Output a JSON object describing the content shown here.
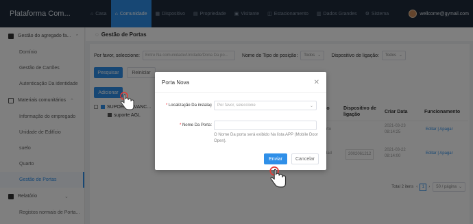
{
  "app": {
    "brand": "Plataforma Com..."
  },
  "nav": [
    {
      "icon": "home-icon",
      "glyph": "⌂",
      "label": "Casa"
    },
    {
      "icon": "community-icon",
      "glyph": "⌂",
      "label": "Comunidade"
    },
    {
      "icon": "device-icon",
      "glyph": "▦",
      "label": "Dispositivo"
    },
    {
      "icon": "property-icon",
      "glyph": "▤",
      "label": "Propriedade"
    },
    {
      "icon": "visitor-icon",
      "glyph": "▣",
      "label": "Visitante"
    },
    {
      "icon": "parking-icon",
      "glyph": "◫",
      "label": "Estacionamento"
    },
    {
      "icon": "bigdata-icon",
      "glyph": "▥",
      "label": "Dados Grandes"
    },
    {
      "icon": "gear-icon",
      "glyph": "⚙",
      "label": "Sistema"
    }
  ],
  "user": {
    "email": "wellcome@gymail.com"
  },
  "sidebar": {
    "group1": "Gestão do agregado fa...",
    "group1_items": [
      "Domínio",
      "Gestão de Cartões",
      "Autenticação Da identidade"
    ],
    "group2": "Materiais comunitários",
    "group2_items": [
      "Informação do empregado",
      "Unidade de Edifício",
      "suelo",
      "Quarto",
      "Gestão de Portas"
    ],
    "group3": "Relatório",
    "group3_items": [
      "Registos normais de Porta..."
    ]
  },
  "page": {
    "title": "Gestão de Portas"
  },
  "filters": {
    "community_label": "Por favor, seleccione:",
    "community_placeholder": "Entre Na comunidade/Unidade/Dona Da po...",
    "position_type_label": "Nome do Tipo de posição:",
    "position_type_value": "Todos",
    "link_device_label": "Dispositivo de ligação:",
    "link_device_value": "Todos"
  },
  "buttons": {
    "search": "Pesquisar",
    "reset": "Reiniciar",
    "add": "Adicionar"
  },
  "tree": {
    "node1": "SUPORTE AVANC...",
    "node2": "suporte AGL"
  },
  "table": {
    "headers": [
      "Tipo de",
      "Dispositivo de ligação",
      "Criar Data",
      "Funcionamento"
    ],
    "rows": [
      {
        "type": "quarto",
        "device": "",
        "date": "2021-03-23 08:14:25",
        "edit": "Editar",
        "delete": "Apagar"
      },
      {
        "type": "unidad",
        "device": "2002061212",
        "date": "2021-03-22 08:14:00",
        "edit": "Editar",
        "delete": "Apagar"
      }
    ]
  },
  "pagination": {
    "total": "Total 2 itens",
    "current": "1",
    "page_size": "50 / página"
  },
  "dialog": {
    "title": "Porta Nova",
    "location_label": "Localização Da instalaç",
    "location_placeholder": "Por favor, seleccione",
    "door_name_label": "Nome Da Porta:",
    "door_name_value": "",
    "hint": "O Nome Da porta será exibido Na lista APP (Mobile Door Open).",
    "submit": "Enviar",
    "cancel": "Cancelar"
  },
  "colors": {
    "accent": "#2f8fe8",
    "topbar": "#1e2a3a",
    "overlay": "rgba(0,0,0,0.5)",
    "required": "#f5222d"
  }
}
